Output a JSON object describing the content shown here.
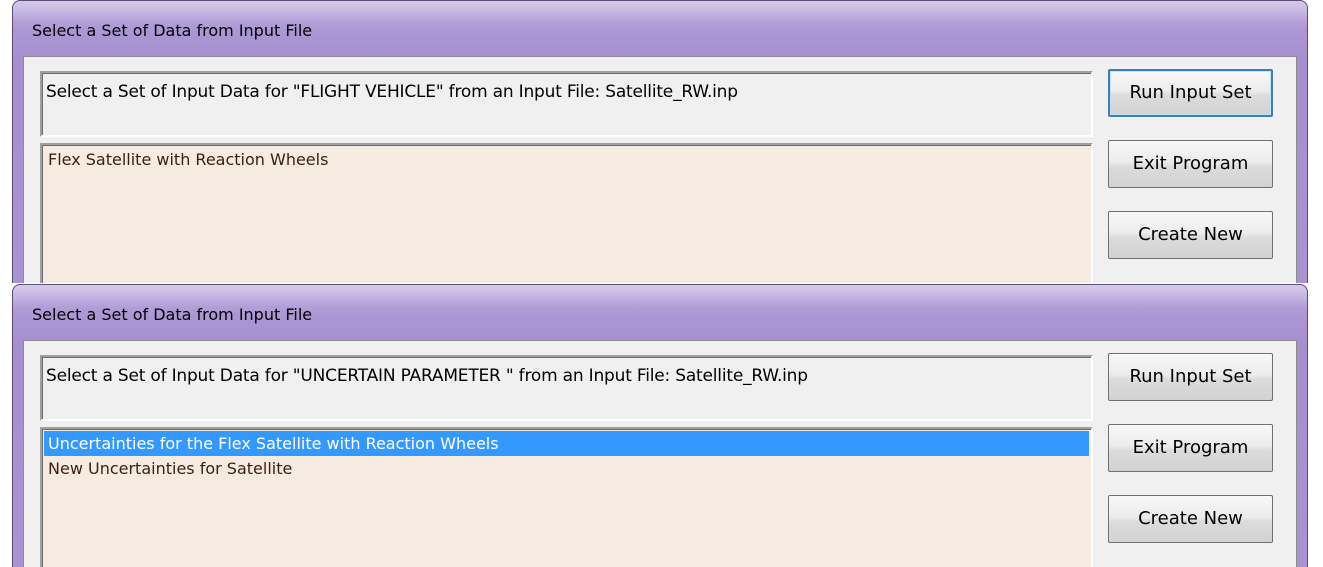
{
  "windows": [
    {
      "title": "Select a Set of Data from Input File",
      "prompt": "Select a Set of Input Data for \"FLIGHT VEHICLE\" from an Input File: Satellite_RW.inp",
      "list_items": [
        {
          "label": "Flex Satellite with Reaction Wheels",
          "selected": false
        }
      ],
      "buttons": {
        "run": "Run Input Set",
        "exit": "Exit Program",
        "create": "Create New"
      }
    },
    {
      "title": "Select a Set of Data from Input File",
      "prompt": "Select a Set of Input Data for \"UNCERTAIN PARAMETER \" from an Input File: Satellite_RW.inp",
      "list_items": [
        {
          "label": "Uncertainties for the Flex Satellite with Reaction Wheels",
          "selected": true
        },
        {
          "label": "New Uncertainties for Satellite",
          "selected": false
        }
      ],
      "buttons": {
        "run": "Run Input Set",
        "exit": "Exit Program",
        "create": "Create New"
      }
    }
  ],
  "colors": {
    "title_bar": "#a994d2",
    "list_background": "#f6ebe1",
    "selection": "#3399ff",
    "dialog_background": "#f0f0f0"
  }
}
